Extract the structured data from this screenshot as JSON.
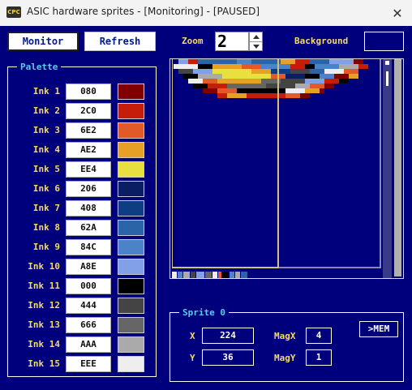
{
  "window": {
    "title": "ASIC hardware sprites - [Monitoring] - [PAUSED]",
    "icon_text": "CPC",
    "close_glyph": "✕"
  },
  "toolbar": {
    "monitor_label": "Monitor",
    "refresh_label": "Refresh",
    "zoom_label": "Zoom",
    "zoom_value": "2",
    "background_label": "Background"
  },
  "palette": {
    "title": "Palette",
    "inks": [
      {
        "label": "Ink 1",
        "value": "080",
        "color": "#800000"
      },
      {
        "label": "Ink 2",
        "value": "2C0",
        "color": "#c41e0a"
      },
      {
        "label": "Ink 3",
        "value": "6E2",
        "color": "#e15a28"
      },
      {
        "label": "Ink 4",
        "value": "AE2",
        "color": "#e6a026"
      },
      {
        "label": "Ink 5",
        "value": "EE4",
        "color": "#e8e03e"
      },
      {
        "label": "Ink 6",
        "value": "206",
        "color": "#0a1e64"
      },
      {
        "label": "Ink 7",
        "value": "408",
        "color": "#0f3d82"
      },
      {
        "label": "Ink 8",
        "value": "62A",
        "color": "#2c64a8"
      },
      {
        "label": "Ink 9",
        "value": "84C",
        "color": "#4b82c8"
      },
      {
        "label": "Ink 10",
        "value": "A8E",
        "color": "#82a0e6"
      },
      {
        "label": "Ink 11",
        "value": "000",
        "color": "#000000"
      },
      {
        "label": "Ink 12",
        "value": "444",
        "color": "#444444"
      },
      {
        "label": "Ink 13",
        "value": "666",
        "color": "#666666"
      },
      {
        "label": "Ink 14",
        "value": "AAA",
        "color": "#aaaaaa"
      },
      {
        "label": "Ink 15",
        "value": "EEE",
        "color": "#eeeeee"
      }
    ]
  },
  "sprite": {
    "title": "Sprite 0",
    "x_label": "X",
    "x_value": "224",
    "y_label": "Y",
    "y_value": "36",
    "magx_label": "MagX",
    "magx_value": "4",
    "magy_label": "MagY",
    "magy_value": "1",
    "mem_button": ">MEM"
  }
}
